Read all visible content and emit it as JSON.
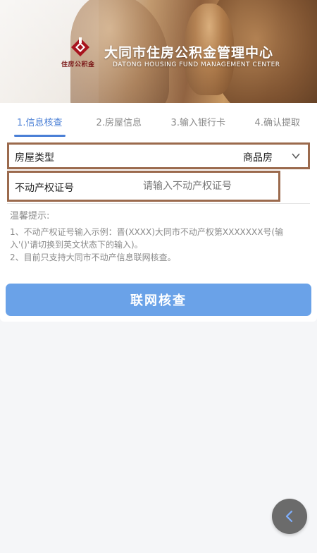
{
  "banner": {
    "logo_sub": "住房公积金",
    "center_name": "大同市住房公积金管理中心",
    "center_en": "DATONG HOUSING FUND MANAGEMENT CENTER"
  },
  "steps": [
    {
      "label": "1.信息核查",
      "active": true
    },
    {
      "label": "2.房屋信息",
      "active": false
    },
    {
      "label": "3.输入银行卡",
      "active": false
    },
    {
      "label": "4.确认提取",
      "active": false
    }
  ],
  "form": {
    "house_type_label": "房屋类型",
    "house_type_value": "商品房",
    "cert_label": "不动产权证号",
    "cert_placeholder": "请输入不动产权证号"
  },
  "tips": {
    "title": "温馨提示:",
    "line1": "1、不动产权证号输入示例：晋(XXXX)大同市不动产权第XXXXXXX号(输入'()'请切换到英文状态下的输入)。",
    "line2": "2、目前只支持大同市不动产信息联网核查。"
  },
  "submit_label": "联网核查",
  "colors": {
    "accent": "#4a7fd6",
    "button": "#6aa2e8",
    "highlight_border": "#9b6a4d"
  }
}
